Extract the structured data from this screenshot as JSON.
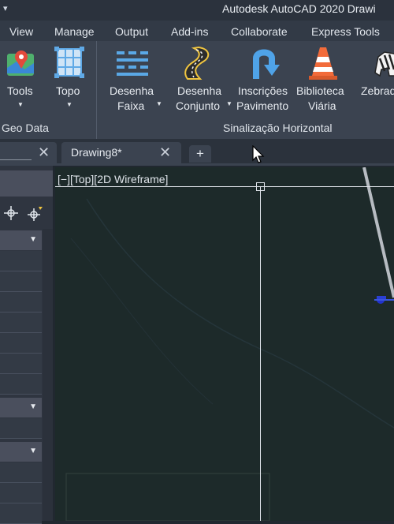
{
  "app": {
    "title": "Autodesk AutoCAD 2020   Drawi",
    "menu_caret": "▾"
  },
  "ribbon_tabs": [
    "View",
    "Manage",
    "Output",
    "Add-ins",
    "Collaborate",
    "Express Tools"
  ],
  "ribbon": {
    "tools_label": "Tools",
    "topo_label": "Topo",
    "geo_panel_title": "Geo Data",
    "faixa_line1": "Desenha",
    "faixa_line2": "Faixa",
    "conjunto_line1": "Desenha",
    "conjunto_line2": "Conjunto",
    "inscricoes_line1": "Inscrições",
    "inscricoes_line2": "Pavimento",
    "biblioteca_line1": "Biblioteca",
    "biblioteca_line2": "Viária",
    "zebra_label": "Zebrad",
    "sinalizacao_title": "Sinalização Horizontal"
  },
  "doc_tabs": {
    "drawing_name": "Drawing8*",
    "close_glyph": "✕",
    "new_tab_glyph": "+"
  },
  "viewport": {
    "label": "[−][Top][2D Wireframe]"
  },
  "colors": {
    "background": "#1d2a2a",
    "ribbon": "#3b4350",
    "accent_blue": "#3a6fd8"
  }
}
